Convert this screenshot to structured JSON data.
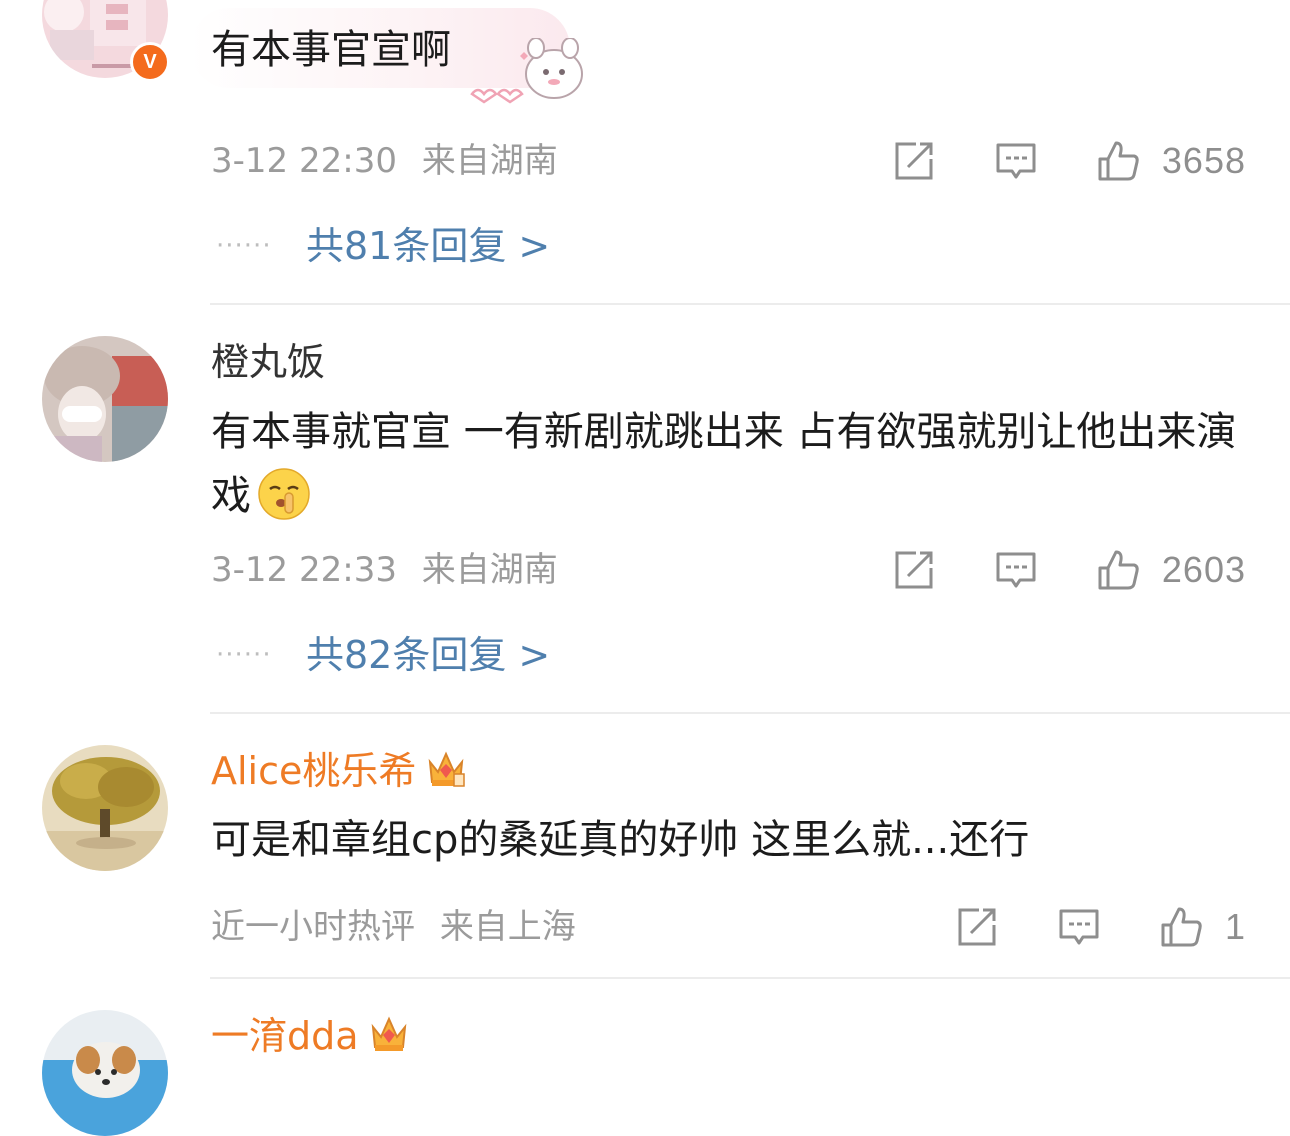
{
  "comments": [
    {
      "username": "",
      "text": "有本事官宣啊",
      "verified_badge": "V",
      "time": "3-12 22:30",
      "location": "来自湖南",
      "likes": "3658",
      "replies": "共81条回复 >"
    },
    {
      "username": "橙丸饭",
      "text": "有本事就官宣 一有新剧就跳出来 占有欲强就别让他出来演戏",
      "emoji": "shush-face-emoji",
      "time": "3-12 22:33",
      "location": "来自湖南",
      "likes": "2603",
      "replies": "共82条回复 >"
    },
    {
      "username": "Alice桃乐希",
      "badge": "crown-icon",
      "text": "可是和章组cp的桑延真的好帅 这里么就...还行",
      "time": "近一小时热评",
      "location": "来自上海",
      "likes": "1"
    },
    {
      "username": "一淯dda",
      "badge": "crown-icon"
    }
  ],
  "colors": {
    "vip_name": "#ee7b25",
    "reply_link": "#4f7fad",
    "meta_text": "#9b9b9b",
    "verified_badge": "#f46b1d"
  },
  "icons": [
    "repost-icon",
    "comment-icon",
    "like-icon"
  ]
}
